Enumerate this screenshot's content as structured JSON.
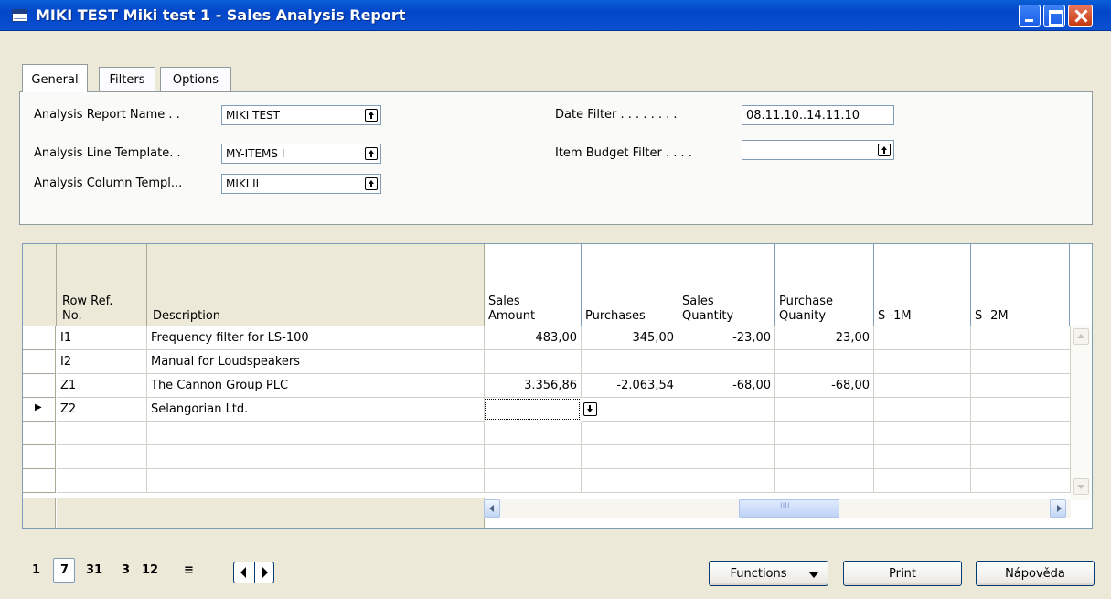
{
  "window": {
    "title": "MIKI TEST Miki test 1 - Sales Analysis Report"
  },
  "tabs": [
    {
      "label": "General"
    },
    {
      "label": "Filters"
    },
    {
      "label": "Options"
    }
  ],
  "general": {
    "report_name_label": "Analysis Report Name . .",
    "report_name_value": "MIKI TEST",
    "line_template_label": "Analysis Line Template. .",
    "line_template_value": "MY-ITEMS I",
    "column_template_label": "Analysis Column Templ...",
    "column_template_value": "MIKI II",
    "date_filter_label": "Date Filter . . . . . . . .",
    "date_filter_value": "08.11.10..14.11.10",
    "budget_filter_label": "Item Budget Filter . . . .",
    "budget_filter_value": ""
  },
  "grid": {
    "headers": {
      "rowref": [
        "Row Ref.",
        "No."
      ],
      "description": "Description",
      "sales_amount": [
        "Sales",
        "Amount"
      ],
      "purchases": "Purchases",
      "sales_qty": [
        "Sales",
        "Quantity"
      ],
      "purchase_qty": [
        "Purchase",
        "Quanity"
      ],
      "s1m": "S -1M",
      "s2m": "S -2M"
    },
    "rows": [
      {
        "ref": "I1",
        "desc": "Frequency filter for LS-100",
        "sales": "483,00",
        "purch": "345,00",
        "sqty": "-23,00",
        "pqty": "23,00"
      },
      {
        "ref": "I2",
        "desc": "Manual for Loudspeakers",
        "sales": "",
        "purch": "",
        "sqty": "",
        "pqty": ""
      },
      {
        "ref": "Z1",
        "desc": "The Cannon Group PLC",
        "sales": "3.356,86",
        "purch": "-2.063,54",
        "sqty": "-68,00",
        "pqty": "-68,00"
      },
      {
        "ref": "Z2",
        "desc": "Selangorian Ltd.",
        "sales": "",
        "purch": "",
        "sqty": "",
        "pqty": ""
      }
    ],
    "current_row_marker": "▶"
  },
  "scroll": {
    "thumb_grip": "IIII"
  },
  "period_nav": {
    "day": "1",
    "week": "7",
    "month": "31",
    "quarter": "3",
    "year": "12",
    "period": "≡"
  },
  "buttons": {
    "functions": "Functions",
    "print": "Print",
    "help": "Nápověda"
  }
}
